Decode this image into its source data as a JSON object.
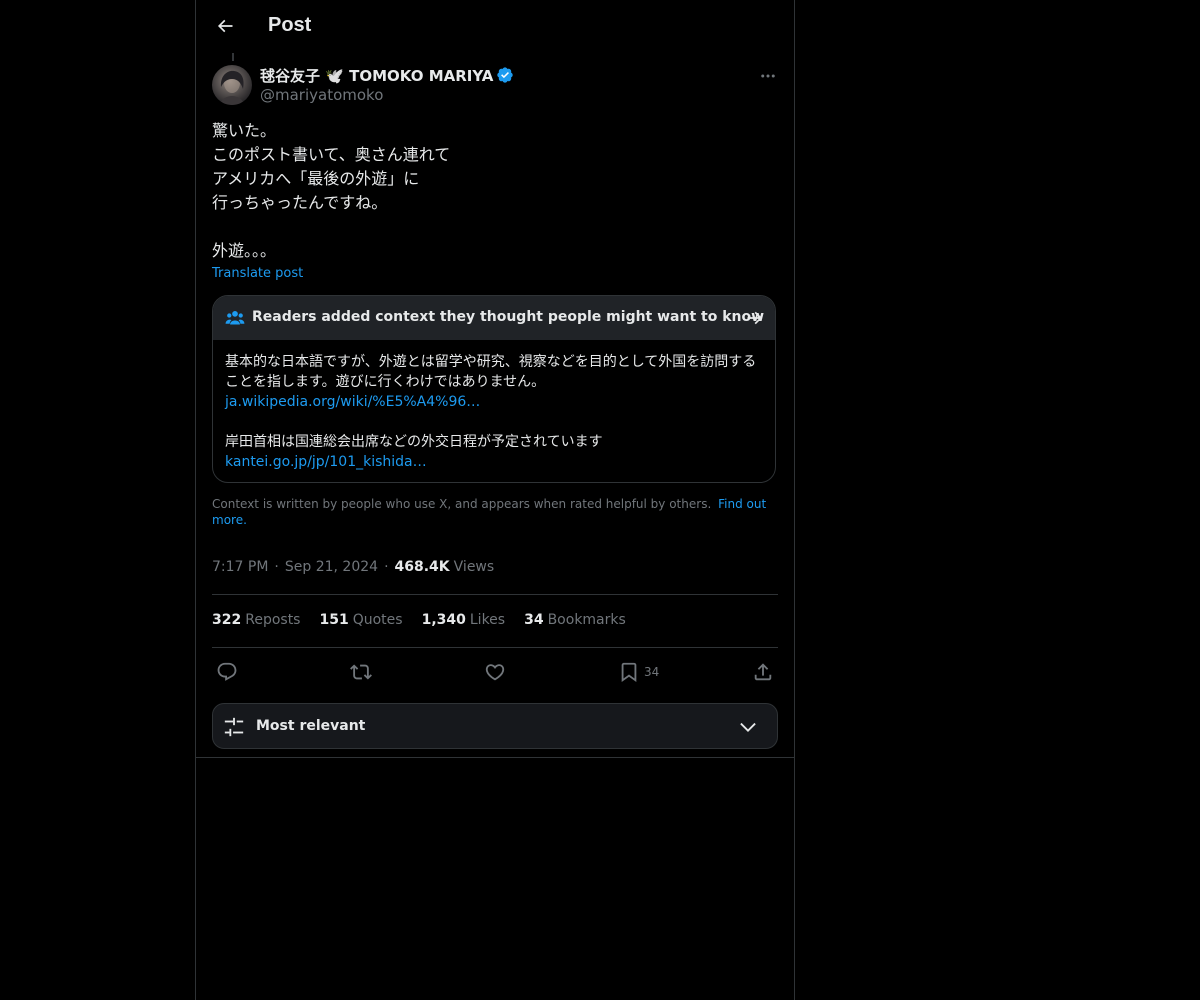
{
  "header": {
    "title": "Post"
  },
  "author": {
    "display_name": "毬谷友子 🕊️ TOMOKO MARIYA",
    "handle": "@mariyatomoko",
    "verified": true
  },
  "post": {
    "text": "驚いた。\nこのポスト書いて、奥さん連れて\nアメリカへ「最後の外遊」に\n行っちゃったんですね。\n\n外遊。。。",
    "translate_label": "Translate post",
    "time": "7:17 PM",
    "date": "Sep 21, 2024",
    "views_count": "468.4K",
    "views_label": "Views"
  },
  "community_note": {
    "title": "Readers added context they thought people might want to know",
    "paragraph1": "基本的な日本語ですが、外遊とは留学や研究、視察などを目的として外国を訪問することを指します。遊びに行くわけではありません。",
    "link1": "ja.wikipedia.org/wiki/%E5%A4%96…",
    "paragraph2": "岸田首相は国連総会出席などの外交日程が予定されています",
    "link2": "kantei.go.jp/jp/101_kishida…"
  },
  "context_footer": {
    "text": "Context is written by people who use X, and appears when rated helpful by others.",
    "link": "Find out more."
  },
  "stats": {
    "reposts": {
      "count": "322",
      "label": "Reposts"
    },
    "quotes": {
      "count": "151",
      "label": "Quotes"
    },
    "likes": {
      "count": "1,340",
      "label": "Likes"
    },
    "bookmarks": {
      "count": "34",
      "label": "Bookmarks"
    }
  },
  "actions": {
    "bookmark_count": "34"
  },
  "sort": {
    "label": "Most relevant"
  },
  "colors": {
    "background": "#000000",
    "text": "#e7e9ea",
    "muted": "#71767b",
    "link": "#1d9bf0",
    "border": "#2f3336",
    "note_header_bg": "#202327"
  }
}
